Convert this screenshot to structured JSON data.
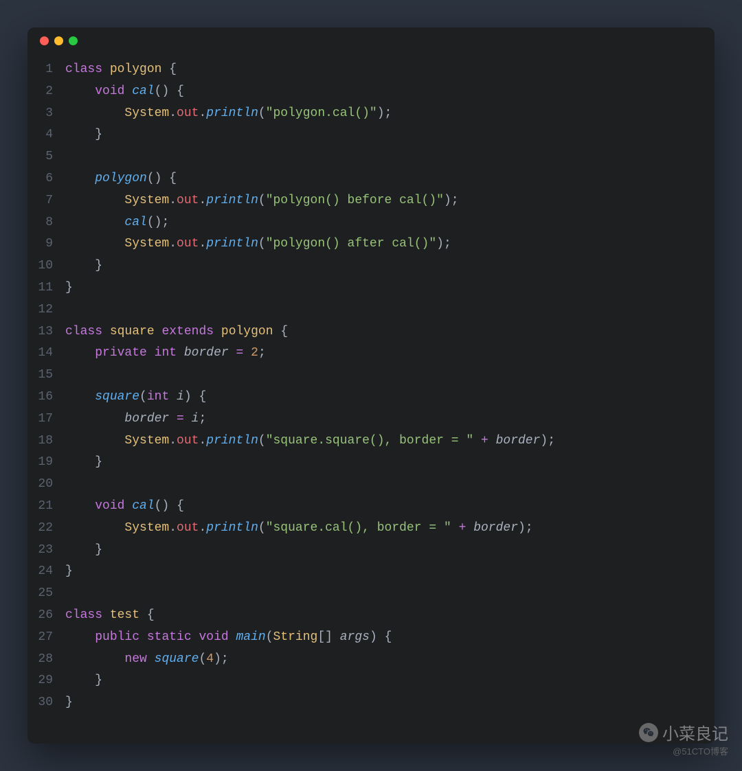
{
  "watermark": {
    "main": "小菜良记",
    "sub": "@51CTO博客"
  },
  "traffic": {
    "red": "close",
    "yellow": "minimize",
    "green": "zoom"
  },
  "code": {
    "str1": "\"polygon.cal()\"",
    "str2": "\"polygon() before cal()\"",
    "str3": "\"polygon() after cal()\"",
    "str4": "\"square.square(), border = \"",
    "str5": "\"square.cal(), border = \"",
    "num2": "2",
    "num4": "4",
    "kw_class": "class",
    "kw_void": "void",
    "kw_private": "private",
    "kw_int": "int",
    "kw_extends": "extends",
    "kw_public": "public",
    "kw_static": "static",
    "kw_new": "new",
    "cls_polygon": "polygon",
    "cls_square": "square",
    "cls_test": "test",
    "cls_String": "String",
    "cls_System": "System",
    "fn_cal": "cal",
    "fn_main": "main",
    "fn_println": "println",
    "fn_square": "square",
    "fn_polygon": "polygon",
    "var_out": "out",
    "var_border": "border",
    "var_i": "i",
    "var_args": "args",
    "op_eq": "=",
    "op_plus": "+",
    "p_open": "(",
    "p_close": ")",
    "b_open": "{",
    "b_close": "}",
    "sb_open": "[",
    "sb_close": "]",
    "semi": ";",
    "dot": ".",
    "sp1": " ",
    "ind1": "    ",
    "ind2": "        "
  },
  "linenos": [
    "1",
    "2",
    "3",
    "4",
    "5",
    "6",
    "7",
    "8",
    "9",
    "10",
    "11",
    "12",
    "13",
    "14",
    "15",
    "16",
    "17",
    "18",
    "19",
    "20",
    "21",
    "22",
    "23",
    "24",
    "25",
    "26",
    "27",
    "28",
    "29",
    "30"
  ]
}
